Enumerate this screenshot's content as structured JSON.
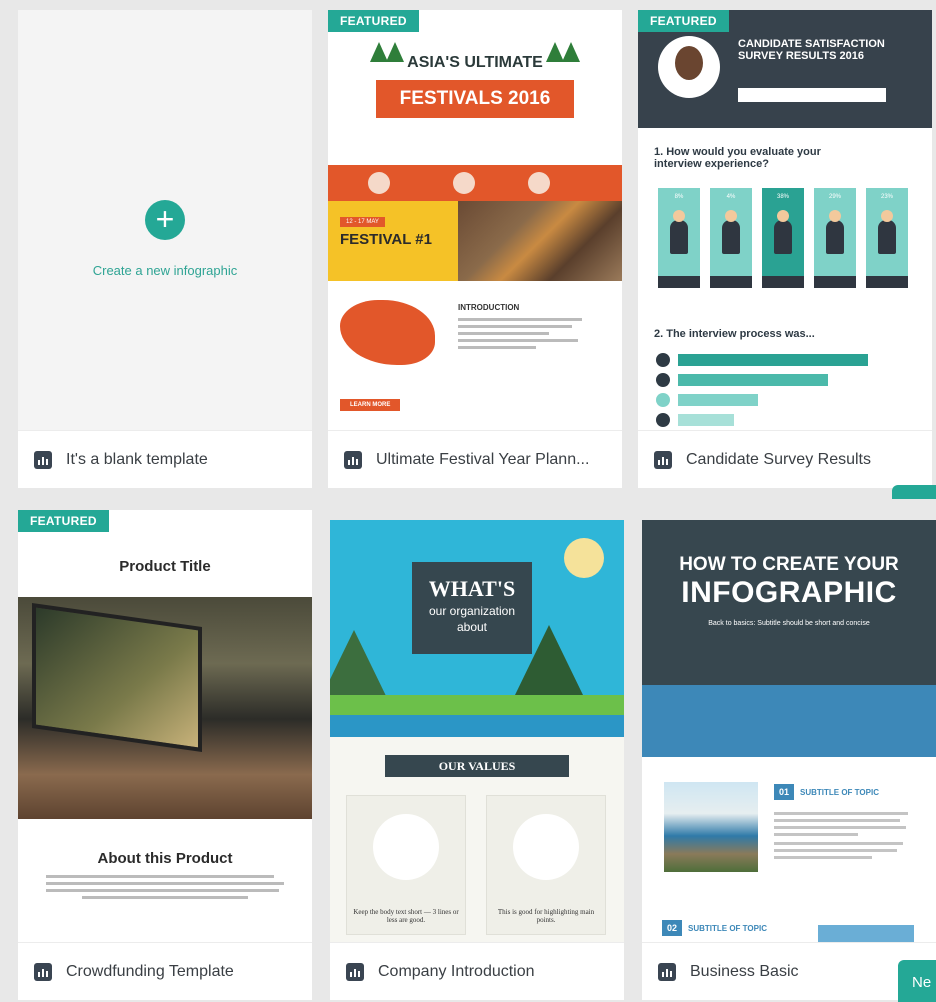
{
  "cards": [
    {
      "title": "It's a blank template",
      "create_text": "Create a new infographic"
    },
    {
      "title": "Ultimate Festival Year Plann...",
      "badge": "FEATURED",
      "preview": {
        "title": "ASIA'S ULTIMATE",
        "banner": "FESTIVALS 2016",
        "tag": "12 - 17 MAY",
        "festival": "FESTIVAL #1",
        "intro": "INTRODUCTION",
        "button": "LEARN MORE"
      }
    },
    {
      "title": "Candidate Survey Results",
      "badge": "FEATURED",
      "preview": {
        "title1": "CANDIDATE SATISFACTION",
        "title2": "SURVEY RESULTS 2016",
        "q1": "1. How would you evaluate your interview experience?",
        "q2": "2. The interview process was...",
        "percents": [
          "8%",
          "4%",
          "38%",
          "29%",
          "23%"
        ]
      }
    },
    {
      "title": "Crowdfunding Template",
      "badge": "FEATURED",
      "preview": {
        "title": "Product Title",
        "subtitle": "About this Product"
      }
    },
    {
      "title": "Company Introduction",
      "preview": {
        "line1": "WHAT'S",
        "line2": "our organization",
        "line3": "about",
        "values": "OUR VALUES",
        "panel1": "Keep the body text short — 3 lines or less are good.",
        "panel2": "This is good for highlighting main points."
      }
    },
    {
      "title": "Business Basic",
      "preview": {
        "line1": "HOW TO CREATE YOUR",
        "line2": "INFOGRAPHIC",
        "subtitle": "Back to basics: Subtitle should be short and concise",
        "num1": "01",
        "sub1": "SUBTITLE OF TOPIC",
        "num2": "02",
        "sub2": "SUBTITLE OF TOPIC"
      }
    }
  ],
  "next_button": "Ne",
  "colors": {
    "accent": "#24a896",
    "festival": "#e2572a",
    "survey_dark": "#37424c",
    "business_blue": "#3d88b8"
  }
}
